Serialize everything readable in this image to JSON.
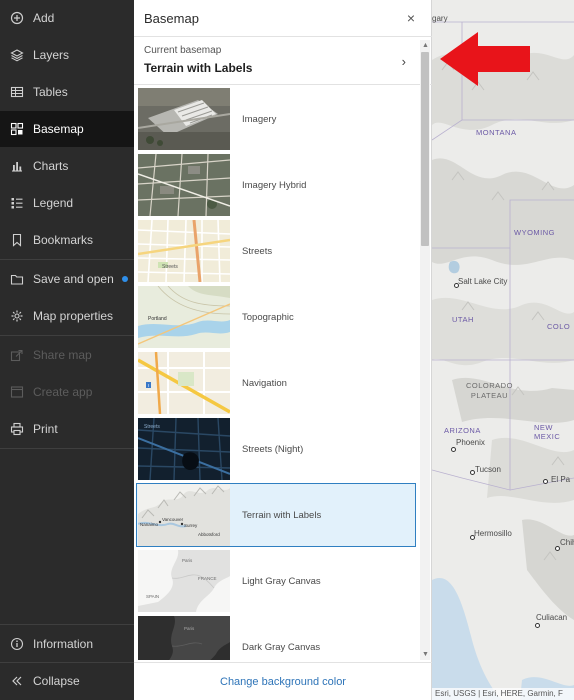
{
  "nav": {
    "items": [
      {
        "label": "Add",
        "icon": "plus-circle-icon"
      },
      {
        "label": "Layers",
        "icon": "layers-icon"
      },
      {
        "label": "Tables",
        "icon": "table-icon"
      },
      {
        "label": "Basemap",
        "icon": "basemap-icon",
        "active": true
      },
      {
        "label": "Charts",
        "icon": "chart-icon"
      },
      {
        "label": "Legend",
        "icon": "legend-icon"
      },
      {
        "label": "Bookmarks",
        "icon": "bookmark-icon"
      },
      {
        "label": "Save and open",
        "icon": "folder-icon",
        "badge": true
      },
      {
        "label": "Map properties",
        "icon": "gear-icon"
      },
      {
        "label": "Share map",
        "icon": "share-icon",
        "disabled": true
      },
      {
        "label": "Create app",
        "icon": "app-icon",
        "disabled": true
      },
      {
        "label": "Print",
        "icon": "print-icon"
      }
    ],
    "bottom": [
      {
        "label": "Information",
        "icon": "info-icon"
      },
      {
        "label": "Collapse",
        "icon": "collapse-icon"
      }
    ]
  },
  "panel": {
    "title": "Basemap",
    "close_symbol": "×",
    "current_label": "Current basemap",
    "current_value": "Terrain with Labels",
    "chevron": "›",
    "basemaps": [
      {
        "label": "Imagery",
        "thumb": "imagery"
      },
      {
        "label": "Imagery Hybrid",
        "thumb": "hybrid"
      },
      {
        "label": "Streets",
        "thumb": "streets"
      },
      {
        "label": "Topographic",
        "thumb": "topo"
      },
      {
        "label": "Navigation",
        "thumb": "navigation"
      },
      {
        "label": "Streets (Night)",
        "thumb": "night"
      },
      {
        "label": "Terrain with Labels",
        "thumb": "terrain",
        "selected": true
      },
      {
        "label": "Light Gray Canvas",
        "thumb": "lightgray"
      },
      {
        "label": "Dark Gray Canvas",
        "thumb": "darkgray"
      }
    ],
    "footer_link": "Change background color"
  },
  "map": {
    "labels": {
      "calgary": "gary",
      "montana": "MONTANA",
      "wyoming": "WYOMING",
      "salt_lake_city": "Salt Lake City",
      "utah": "UTAH",
      "colorado": "COLO",
      "colorado_plateau_1": "COLORADO",
      "colorado_plateau_2": "PLATEAU",
      "arizona": "ARIZONA",
      "new_mexico": "NEW MEXIC",
      "phoenix": "Phoenix",
      "tucson": "Tucson",
      "el_paso": "El Pa",
      "hermosillo": "Hermosillo",
      "chihuahua": "Chih",
      "culiacan": "Culiacan"
    },
    "attribution": "Esri, USGS | Esri, HERE, Garmin, F"
  },
  "colors": {
    "nav_bg": "#2b2b2b",
    "nav_active": "#151515",
    "accent_blue": "#2f7fc1",
    "selected_bg": "#e2f1fb",
    "arrow_red": "#e8141a"
  }
}
